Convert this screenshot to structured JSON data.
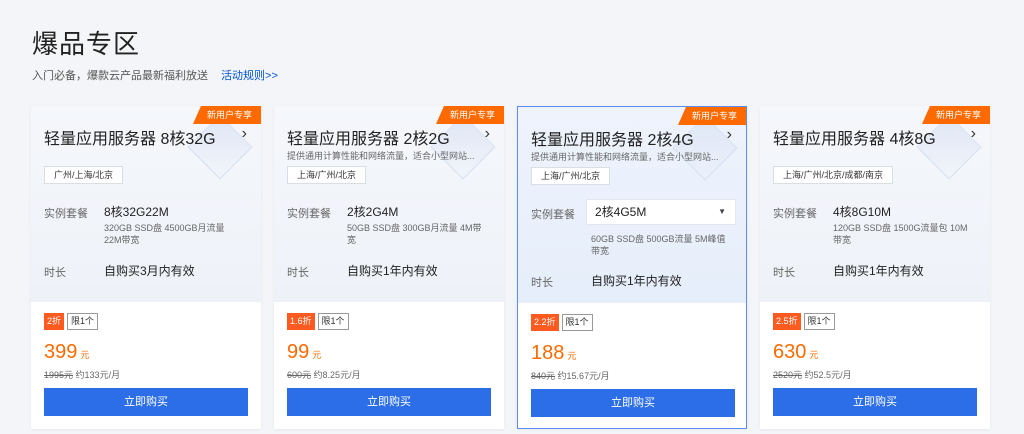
{
  "header": {
    "title": "爆品专区",
    "subtitle": "入门必备，爆款云产品最新福利放送",
    "rules_link": "活动规则>>"
  },
  "cards": [
    {
      "ribbon": "新用户专享",
      "title": "轻量应用服务器 8核32G",
      "desc": "",
      "region": "广州/上海/北京",
      "spec_label": "实例套餐",
      "spec_value": "8核32G22M",
      "spec_detail": "320GB SSD盘 4500GB月流量 22M带宽",
      "duration_label": "时长",
      "duration_value": "自购买3月内有效",
      "discount": "2折",
      "limit": "限1个",
      "price": "399",
      "price_unit": "元",
      "original_price": "1995元",
      "monthly": "约133元/月",
      "buy_label": "立即购买"
    },
    {
      "ribbon": "新用户专享",
      "title": "轻量应用服务器 2核2G",
      "desc": "提供通用计算性能和网络流量，适合小型网站...",
      "region": "上海/广州/北京",
      "spec_label": "实例套餐",
      "spec_value": "2核2G4M",
      "spec_detail": "50GB SSD盘 300GB月流量 4M带宽",
      "duration_label": "时长",
      "duration_value": "自购买1年内有效",
      "discount": "1.6折",
      "limit": "限1个",
      "price": "99",
      "price_unit": "元",
      "original_price": "600元",
      "monthly": "约8.25元/月",
      "buy_label": "立即购买"
    },
    {
      "ribbon": "新用户专享",
      "title": "轻量应用服务器 2核4G",
      "desc": "提供通用计算性能和网络流量，适合小型网站...",
      "region": "上海/广州/北京",
      "spec_label": "实例套餐",
      "spec_value": "2核4G5M",
      "spec_detail": "60GB SSD盘 500GB流量 5M峰值带宽",
      "duration_label": "时长",
      "duration_value": "自购买1年内有效",
      "discount": "2.2折",
      "limit": "限1个",
      "price": "188",
      "price_unit": "元",
      "original_price": "840元",
      "monthly": "约15.67元/月",
      "buy_label": "立即购买"
    },
    {
      "ribbon": "新用户专享",
      "title": "轻量应用服务器 4核8G",
      "desc": "",
      "region": "上海/广州/北京/成都/南京",
      "spec_label": "实例套餐",
      "spec_value": "4核8G10M",
      "spec_detail": "120GB SSD盘 1500G流量包 10M带宽",
      "duration_label": "时长",
      "duration_value": "自购买1年内有效",
      "discount": "2.5折",
      "limit": "限1个",
      "price": "630",
      "price_unit": "元",
      "original_price": "2520元",
      "monthly": "约52.5元/月",
      "buy_label": "立即购买"
    }
  ],
  "colors": {
    "accent_orange": "#ff6a00",
    "button_blue": "#2c6ee8",
    "link_blue": "#0052d9"
  }
}
